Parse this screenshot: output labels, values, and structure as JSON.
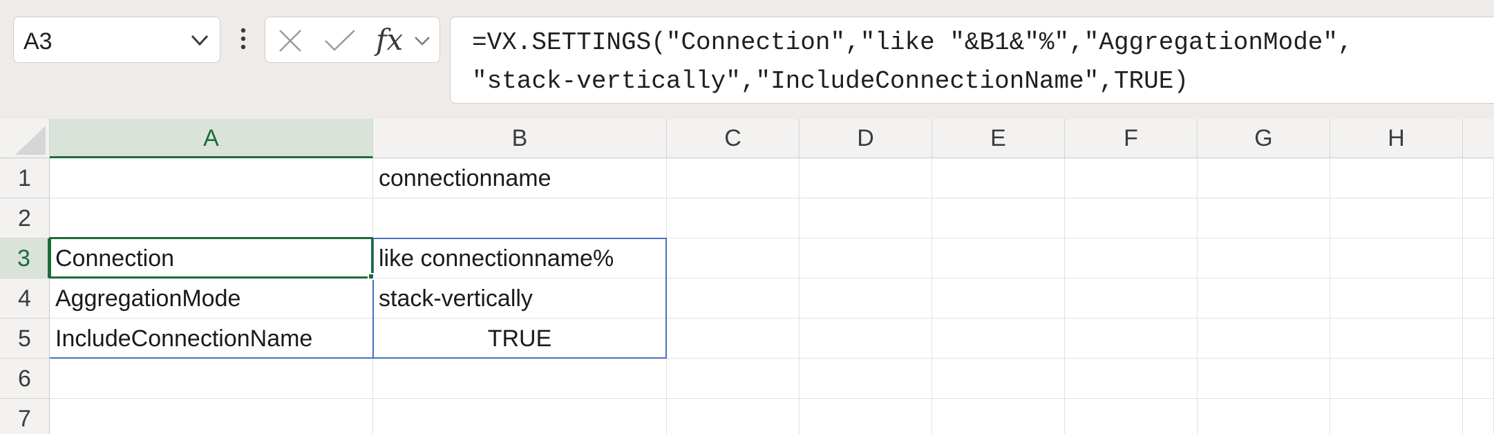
{
  "name_box": {
    "value": "A3"
  },
  "formula_bar": {
    "line1": "=VX.SETTINGS(\"Connection\",\"like \"&B1&\"%\",\"AggregationMode\",",
    "line2": "\"stack-vertically\",\"IncludeConnectionName\",TRUE)",
    "insert_function_label": "fx"
  },
  "icons": {
    "name_box_dropdown": "chevron-down-icon",
    "more_options": "vertical-ellipsis-icon",
    "cancel": "x-icon",
    "enter": "checkmark-icon",
    "insert_function": "function-icon",
    "expand": "chevron-down-icon"
  },
  "grid": {
    "columns": [
      "A",
      "B",
      "C",
      "D",
      "E",
      "F",
      "G",
      "H"
    ],
    "rows": [
      "1",
      "2",
      "3",
      "4",
      "5",
      "6",
      "7"
    ],
    "selected_column": "A",
    "selected_row": "3",
    "cells": {
      "B1": "connectionname",
      "A3": "Connection",
      "B3": "like connectionname%",
      "A4": "AggregationMode",
      "B4": "stack-vertically",
      "A5": "IncludeConnectionName",
      "B5": "TRUE"
    }
  },
  "colors": {
    "selection": "#1e6b3a",
    "spill_border": "#4472c4",
    "header_bg": "#f3f2f1",
    "toolbar_bg": "#eeebe8"
  }
}
